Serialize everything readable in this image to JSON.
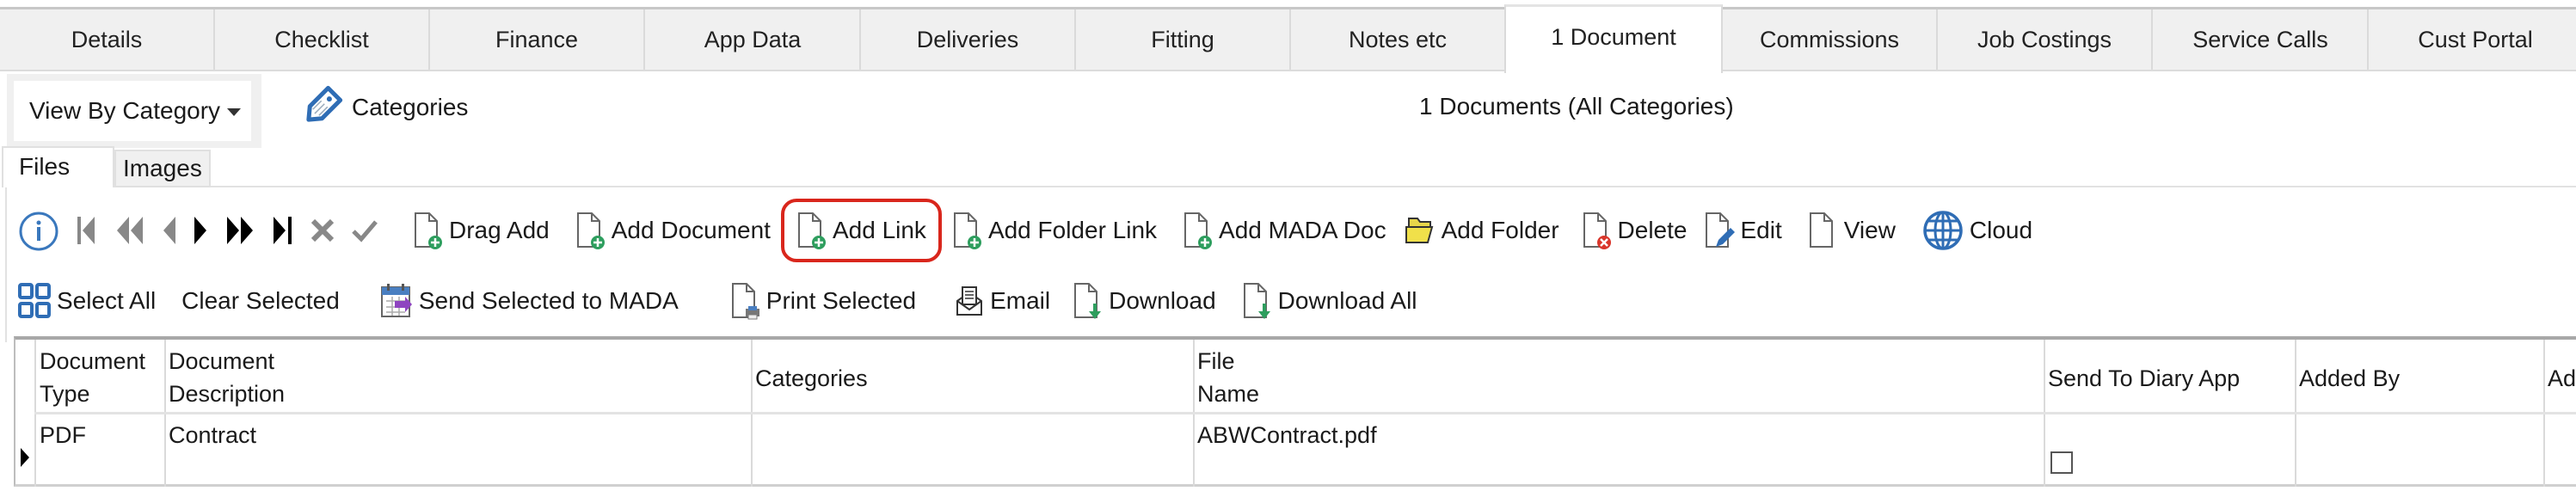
{
  "tabs": [
    {
      "label": "Details",
      "active": false
    },
    {
      "label": "Checklist",
      "active": false
    },
    {
      "label": "Finance",
      "active": false
    },
    {
      "label": "App Data",
      "active": false
    },
    {
      "label": "Deliveries",
      "active": false
    },
    {
      "label": "Fitting",
      "active": false
    },
    {
      "label": "Notes etc",
      "active": false
    },
    {
      "label": "1 Document",
      "active": true
    },
    {
      "label": "Commissions",
      "active": false
    },
    {
      "label": "Job Costings",
      "active": false
    },
    {
      "label": "Service Calls",
      "active": false
    },
    {
      "label": "Cust Portal",
      "active": false
    }
  ],
  "view_by": {
    "selected": "View By Category"
  },
  "categories_button": {
    "label": "Categories",
    "icon": "tag-icon"
  },
  "summary": "1 Documents (All Categories)",
  "subtabs": [
    {
      "label": "Files",
      "active": true
    },
    {
      "label": "Images",
      "active": false
    }
  ],
  "toolbar1": {
    "nav_icons": [
      "info-icon",
      "first-icon",
      "prev-page-icon",
      "prev-icon",
      "next-icon",
      "next-page-icon",
      "last-icon",
      "cancel-icon",
      "confirm-icon"
    ],
    "items": [
      {
        "label": "Drag Add",
        "icon": "document-add-icon"
      },
      {
        "label": "Add Document",
        "icon": "document-add-icon"
      },
      {
        "label": "Add Link",
        "icon": "document-add-icon",
        "highlighted": true
      },
      {
        "label": "Add Folder Link",
        "icon": "document-add-icon"
      },
      {
        "label": "Add MADA Doc",
        "icon": "document-add-icon"
      },
      {
        "label": "Add Folder",
        "icon": "folder-icon"
      },
      {
        "label": "Delete",
        "icon": "document-delete-icon"
      },
      {
        "label": "Edit",
        "icon": "document-edit-icon"
      },
      {
        "label": "View",
        "icon": "document-icon"
      },
      {
        "label": "Cloud",
        "icon": "globe-icon"
      }
    ]
  },
  "toolbar2": {
    "items": [
      {
        "label": "Select All",
        "icon": "grid-icon"
      },
      {
        "label": "Clear Selected",
        "icon": ""
      },
      {
        "label": "Send Selected to MADA",
        "icon": "calendar-send-icon"
      },
      {
        "label": "Print Selected",
        "icon": "document-print-icon"
      },
      {
        "label": "Email",
        "icon": "email-icon"
      },
      {
        "label": "Download",
        "icon": "document-download-icon"
      },
      {
        "label": "Download All",
        "icon": "document-download-icon"
      }
    ]
  },
  "table": {
    "columns": [
      {
        "line1": "Document",
        "line2": "Type"
      },
      {
        "line1": "Document",
        "line2": "Description"
      },
      {
        "line1": "Categories",
        "line2": ""
      },
      {
        "line1": "File",
        "line2": "Name"
      },
      {
        "line1": "Send To Diary App",
        "line2": ""
      },
      {
        "line1": "Added By",
        "line2": ""
      },
      {
        "line1": "Ad",
        "line2": ""
      }
    ],
    "rows": [
      {
        "type": "PDF",
        "description": "Contract",
        "categories": "",
        "file_name": "ABWContract.pdf",
        "send_to_diary_app": false,
        "added_by": ""
      }
    ]
  },
  "colors": {
    "highlight": "#d9261c",
    "icon_blue": "#2f6db5",
    "icon_green": "#2e9e5e",
    "icon_red": "#d9362b"
  }
}
